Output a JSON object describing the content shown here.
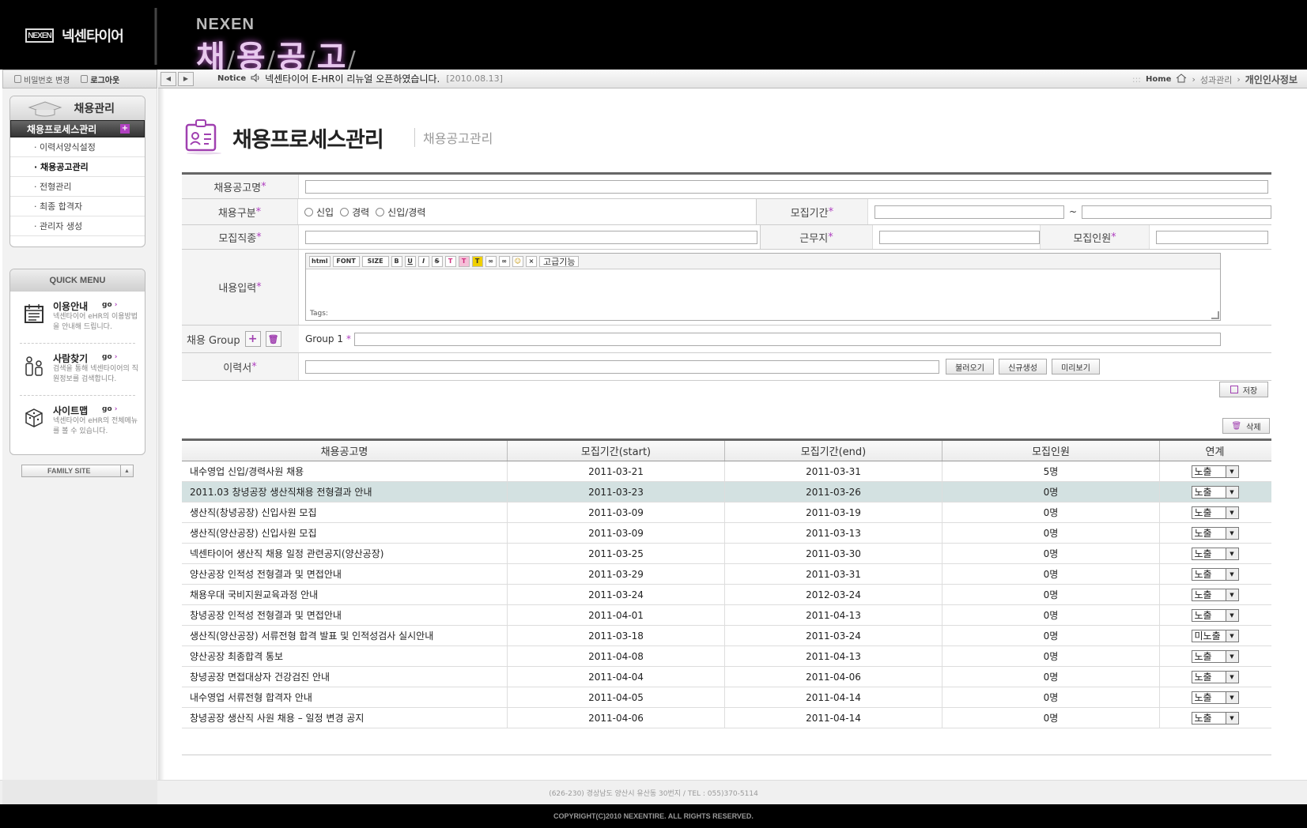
{
  "header": {
    "logo_mark": "NEXEN",
    "logo_text": "넥센타이어",
    "brand": "NEXEN",
    "title_chars": [
      "채",
      "용",
      "공",
      "고"
    ]
  },
  "util": {
    "pw_change": "비밀번호 변경",
    "logout": "로그아웃"
  },
  "notice": {
    "label": "Notice",
    "text": "넥센타이어 E-HR이 리뉴얼 오픈하였습니다.",
    "date": "[2010.08.13]"
  },
  "breadcrumb": [
    "Home",
    "성과관리",
    "개인인사정보"
  ],
  "sidebar": {
    "title": "채용관리",
    "active": "채용프로세스관리",
    "items": [
      "· 이력서양식설정",
      "· 채용공고관리",
      "· 전형관리",
      "· 최종 합격자",
      "· 관리자 생성"
    ]
  },
  "quick_menu": {
    "title": "QUICK MENU",
    "go": "go",
    "items": [
      {
        "title": "이용안내",
        "desc": "넥센타이어 eHR의 이용방법을 안내해 드립니다.",
        "icon": "calendar-icon"
      },
      {
        "title": "사람찾기",
        "desc": "검색을 통해 넥센타이어의 직원정보를 검색합니다.",
        "icon": "people-icon"
      },
      {
        "title": "사이트맵",
        "desc": "넥센타이어 eHR의 전체메뉴를 볼 수 있습니다.",
        "icon": "cube-icon"
      }
    ]
  },
  "family_site": "FAMILY SITE",
  "page": {
    "title": "채용프로세스관리",
    "subtitle": "채용공고관리"
  },
  "form": {
    "name_label": "채용공고명",
    "type_label": "채용구분",
    "type_options": [
      "신입",
      "경력",
      "신입/경력"
    ],
    "period_label": "모집기간",
    "period_sep": "~",
    "job_label": "모집직종",
    "location_label": "근무지",
    "headcount_label": "모집인원",
    "content_label": "내용입력",
    "editor_tools": [
      "html",
      "FONT",
      "SIZE",
      "B",
      "U",
      "I",
      "S",
      "T",
      "T",
      "T",
      "∞",
      "∞",
      "☺",
      "×"
    ],
    "editor_advanced": "고급기능",
    "editor_tags": "Tags:",
    "group_label": "채용 Group",
    "group1_label": "Group 1",
    "resume_label": "이력서",
    "btn_load": "불러오기",
    "btn_new": "신규생성",
    "btn_preview": "미리보기",
    "required_mark": "*"
  },
  "actions": {
    "save": "저장",
    "delete": "삭제"
  },
  "table": {
    "headers": [
      "채용공고명",
      "모집기간(start)",
      "모집기간(end)",
      "모집인원",
      "연계"
    ],
    "rows": [
      {
        "title": "내수영업 신입/경력사원 채용",
        "start": "2011-03-21",
        "end": "2011-03-31",
        "count": "5명",
        "link": "노출"
      },
      {
        "title": "2011.03 창녕공장 생산직채용 전형결과 안내",
        "start": "2011-03-23",
        "end": "2011-03-26",
        "count": "0명",
        "link": "노출"
      },
      {
        "title": "생산직(창녕공장) 신입사원 모집",
        "start": "2011-03-09",
        "end": "2011-03-19",
        "count": "0명",
        "link": "노출"
      },
      {
        "title": "생산직(양산공장) 신입사원 모집",
        "start": "2011-03-09",
        "end": "2011-03-13",
        "count": "0명",
        "link": "노출"
      },
      {
        "title": "넥센타이어 생산직 채용 일정 관련공지(양산공장)",
        "start": "2011-03-25",
        "end": "2011-03-30",
        "count": "0명",
        "link": "노출"
      },
      {
        "title": "양산공장 인적성 전형결과 및 면접안내",
        "start": "2011-03-29",
        "end": "2011-03-31",
        "count": "0명",
        "link": "노출"
      },
      {
        "title": "채용우대 국비지원교육과정 안내",
        "start": "2011-03-24",
        "end": "2012-03-24",
        "count": "0명",
        "link": "노출"
      },
      {
        "title": "창녕공장 인적성 전형결과 및 면접안내",
        "start": "2011-04-01",
        "end": "2011-04-13",
        "count": "0명",
        "link": "노출"
      },
      {
        "title": "생산직(양산공장) 서류전형 합격 발표 및 인적성검사 실시안내",
        "start": "2011-03-18",
        "end": "2011-03-24",
        "count": "0명",
        "link": "미노출"
      },
      {
        "title": "양산공장 최종합격 통보",
        "start": "2011-04-08",
        "end": "2011-04-13",
        "count": "0명",
        "link": "노출"
      },
      {
        "title": "창녕공장 면접대상자 건강검진 안내",
        "start": "2011-04-04",
        "end": "2011-04-06",
        "count": "0명",
        "link": "노출"
      },
      {
        "title": "내수영업 서류전형 합격자 안내",
        "start": "2011-04-05",
        "end": "2011-04-14",
        "count": "0명",
        "link": "노출"
      },
      {
        "title": "창녕공장 생산직 사원 채용 – 일정 변경 공지",
        "start": "2011-04-06",
        "end": "2011-04-14",
        "count": "0명",
        "link": "노출"
      }
    ]
  },
  "footer": {
    "address": "(626-230) 경상남도 양산시 유산동 30번지   /   TEL : 055)370-5114",
    "copyright": "COPYRIGHT(C)2010 NEXENTIRE. ALL RIGHTS RESERVED."
  },
  "colors": {
    "accent": "#b040c0",
    "highlight_row": "#d3e1e1",
    "header_bg": "#000000"
  }
}
